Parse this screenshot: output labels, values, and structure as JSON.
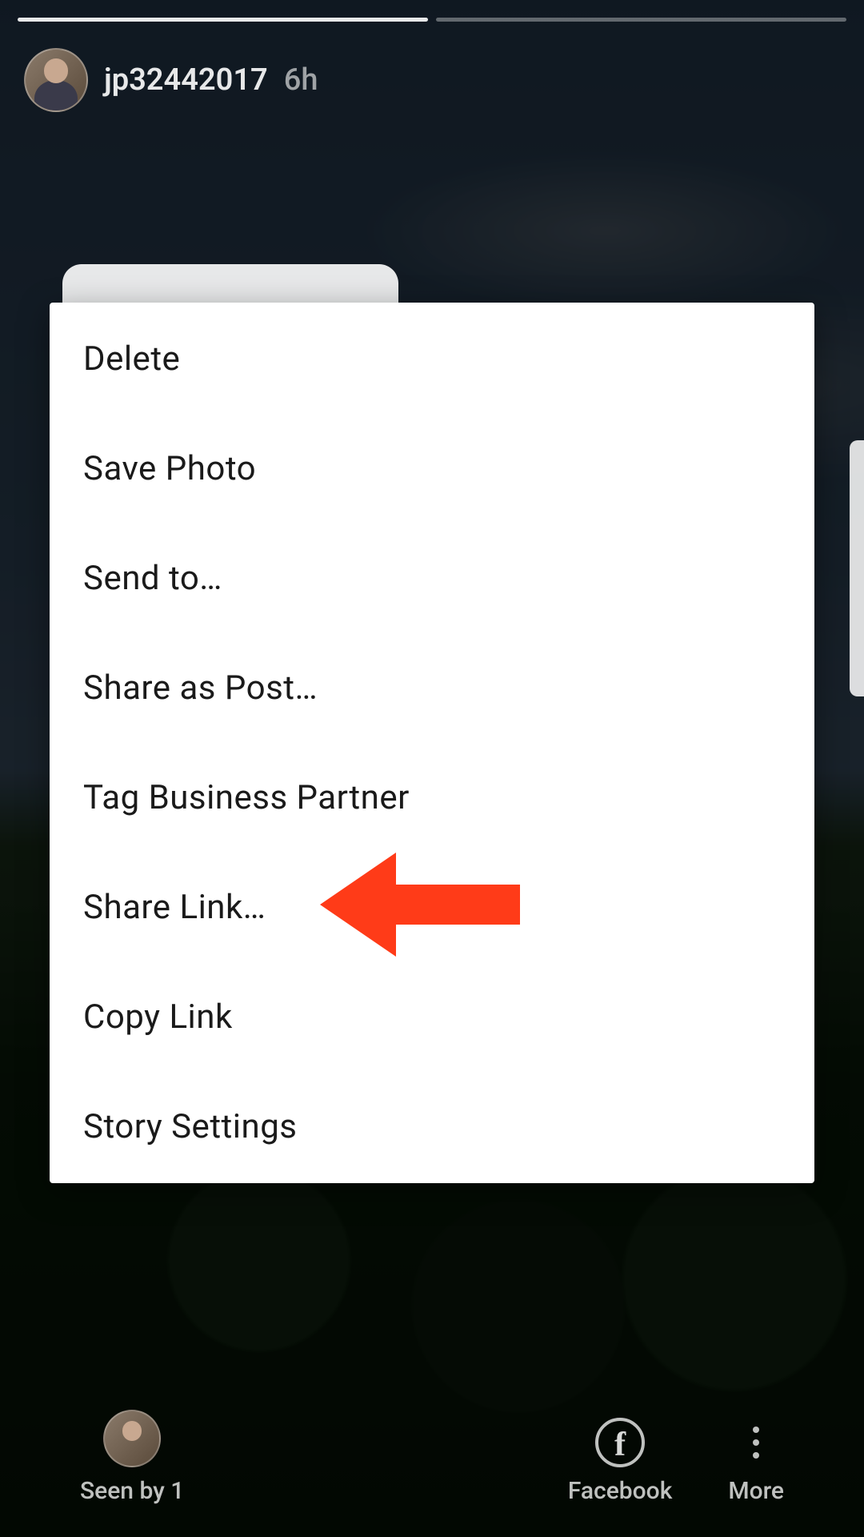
{
  "story": {
    "username": "jp32442017",
    "timestamp": "6h"
  },
  "menu": {
    "items": [
      "Delete",
      "Save Photo",
      "Send to…",
      "Share as Post…",
      "Tag Business Partner",
      "Share Link…",
      "Copy Link",
      "Story Settings"
    ]
  },
  "bottom": {
    "seen_by_label": "Seen by 1",
    "facebook_label": "Facebook",
    "more_label": "More"
  },
  "annotation": {
    "arrow_color": "#ff3b18",
    "points_to_menu_index": 5
  }
}
